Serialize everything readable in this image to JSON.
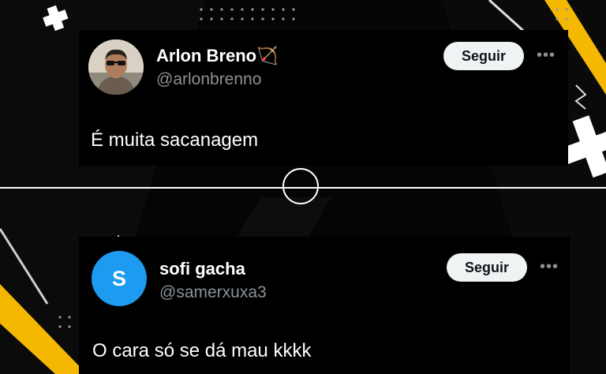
{
  "colors": {
    "background": "#050505",
    "card": "#000000",
    "accent_yellow": "#f5b800",
    "avatar_blue": "#1d9bf0",
    "handle_gray": "#8b9196",
    "button_bg": "#eff3f4"
  },
  "tweets": [
    {
      "name": "Arlon Breno🏹",
      "handle": "@arlonbrenno",
      "follow_label": "Seguir",
      "more_icon": "more-dots-icon",
      "text": "É muita sacanagem",
      "avatar": "photo"
    },
    {
      "name": "sofi gacha",
      "handle": "@samerxuxa3",
      "follow_label": "Seguir",
      "more_icon": "more-dots-icon",
      "text": "O cara só se dá mau kkkk",
      "avatar": "S"
    }
  ]
}
